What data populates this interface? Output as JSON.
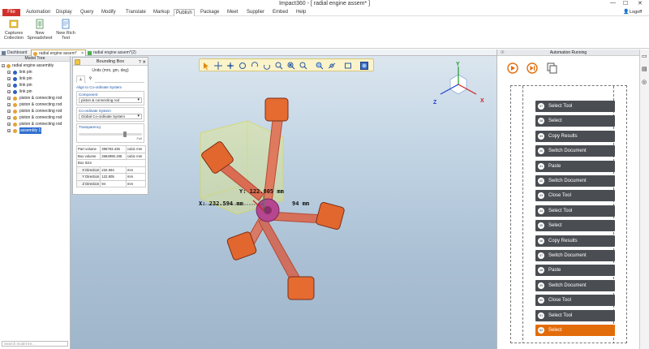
{
  "window": {
    "title": "Impact360 - [ radial engine assem* ]",
    "min": "—",
    "max": "☐",
    "close": "✕"
  },
  "menu": {
    "file": "File",
    "items": [
      "Automation",
      "Display",
      "Query",
      "Modify",
      "Translate",
      "Markup",
      "Publish",
      "Package",
      "Meet",
      "Supplier",
      "Embed",
      "Help"
    ],
    "active": "Publish"
  },
  "user": {
    "logoff": "Logoff"
  },
  "ribbon": {
    "buttons": [
      {
        "label1": "Captures",
        "label2": "Collection"
      },
      {
        "label1": "New",
        "label2": "Spreadsheet"
      },
      {
        "label1": "New Rich",
        "label2": "Text"
      }
    ]
  },
  "doc_tabs": [
    {
      "label": "Dashboard"
    },
    {
      "label": "radial engine assem*"
    },
    {
      "label": "radial engine assem*(2)"
    }
  ],
  "model_tree": {
    "header": "Model Tree",
    "items": [
      {
        "label": "radial engine assembly",
        "level": 0
      },
      {
        "label": "link pin",
        "level": 1
      },
      {
        "label": "link pin",
        "level": 1
      },
      {
        "label": "link pin",
        "level": 1
      },
      {
        "label": "link pin",
        "level": 1
      },
      {
        "label": "piston & connecting rod",
        "level": 1
      },
      {
        "label": "piston & connecting rod",
        "level": 1
      },
      {
        "label": "piston & connecting rod",
        "level": 1
      },
      {
        "label": "piston & connecting rod",
        "level": 1
      },
      {
        "label": "piston & connecting rod",
        "level": 1
      },
      {
        "label": "assembly 1",
        "level": 1
      }
    ],
    "search_placeholder": "Search model tre..."
  },
  "bounding_box": {
    "title": "Bounding Box",
    "units": "Units (mm, gm, deg)",
    "align_label": "Align to Co-ordinate System",
    "component_label": "Component",
    "component_value": "piston & connecting rod",
    "coord_label": "Co-ordinate System",
    "coord_value": "Global Co-ordinate System",
    "transparency_label": "Transparency",
    "slider_none": "",
    "slider_full": "Full",
    "transparency": 0.75,
    "rows": [
      {
        "label": "Part volume",
        "value": "395793.435",
        "unit": "cubic mm"
      },
      {
        "label": "Box volume",
        "value": "2684995.195",
        "unit": "cubic mm"
      },
      {
        "label": "Box Size",
        "value": "",
        "unit": ""
      },
      {
        "label": "X Direction",
        "value": "232.594",
        "unit": "mm"
      },
      {
        "label": "Y Direction",
        "value": "122.805",
        "unit": "mm"
      },
      {
        "label": "Z Direction",
        "value": "94",
        "unit": "mm"
      }
    ]
  },
  "viewport": {
    "x_label": "X: 232.594 mm",
    "y_label": "Y: 122.805 mm",
    "z_label": "94 mm",
    "axes": {
      "x": "X",
      "y": "Y",
      "z": "Z"
    }
  },
  "automation": {
    "header": "Automation Running",
    "pin": "☉",
    "steps": [
      {
        "num": "37",
        "label": "Select Tool"
      },
      {
        "num": "38",
        "label": "Select"
      },
      {
        "num": "39",
        "label": "Copy Results"
      },
      {
        "num": "40",
        "label": "Switch Document"
      },
      {
        "num": "41",
        "label": "Paste"
      },
      {
        "num": "42",
        "label": "Switch Document"
      },
      {
        "num": "43",
        "label": "Close Tool"
      },
      {
        "num": "44",
        "label": "Select Tool"
      },
      {
        "num": "45",
        "label": "Select"
      },
      {
        "num": "46",
        "label": "Copy Results"
      },
      {
        "num": "47",
        "label": "Switch Document"
      },
      {
        "num": "48",
        "label": "Paste"
      },
      {
        "num": "49",
        "label": "Switch Document"
      },
      {
        "num": "50",
        "label": "Close Tool"
      },
      {
        "num": "51",
        "label": "Select Tool"
      },
      {
        "num": "52",
        "label": "Select"
      }
    ],
    "active_step": "52"
  },
  "colors": {
    "accent": "#e36c0a",
    "step_bg": "#4a4d52",
    "file_red": "#d0312d",
    "selection": "#2f6fce"
  }
}
